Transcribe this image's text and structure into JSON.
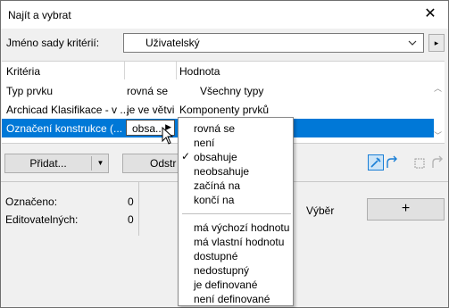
{
  "window": {
    "title": "Najít a vybrat",
    "close_glyph": "✕"
  },
  "criteria_set": {
    "label": "Jméno sady kritérií:",
    "value": "Uživatelský",
    "more_glyph": "▸"
  },
  "grid": {
    "headers": [
      "Kritéria",
      "Hodnota"
    ],
    "rows": [
      {
        "criterion": "Typ prvku",
        "operator": "rovná se",
        "value": "Všechny typy",
        "selected": false
      },
      {
        "criterion": "Archicad Klasifikace - v ...",
        "operator": "je ve větvi",
        "value": "Komponenty prvků",
        "selected": false
      },
      {
        "criterion": "Označení konstrukce (...",
        "operator": "obsa...",
        "value": "",
        "selected": true
      }
    ]
  },
  "buttons": {
    "add": "Přidat...",
    "add_arrow": "▼",
    "remove": "Odstr",
    "select_label": "Výběr",
    "plus": "+"
  },
  "status": {
    "marked_label": "Označeno:",
    "marked_value": "0",
    "editable_label": "Editovatelných:",
    "editable_value": "0"
  },
  "operator_menu": {
    "group1": [
      {
        "label": "rovná se",
        "checked": false
      },
      {
        "label": "není",
        "checked": false
      },
      {
        "label": "obsahuje",
        "checked": true
      },
      {
        "label": "neobsahuje",
        "checked": false
      },
      {
        "label": "začíná na",
        "checked": false
      },
      {
        "label": "končí na",
        "checked": false
      }
    ],
    "group2": [
      {
        "label": "má výchozí hodnotu",
        "checked": false
      },
      {
        "label": "má vlastní hodnotu",
        "checked": false
      },
      {
        "label": "dostupné",
        "checked": false
      },
      {
        "label": "nedostupný",
        "checked": false
      },
      {
        "label": "je definované",
        "checked": false
      },
      {
        "label": "není definované",
        "checked": false
      }
    ],
    "check_glyph": "✓"
  },
  "colors": {
    "selection": "#0078d7",
    "accent_icon": "#1a7fd6"
  }
}
